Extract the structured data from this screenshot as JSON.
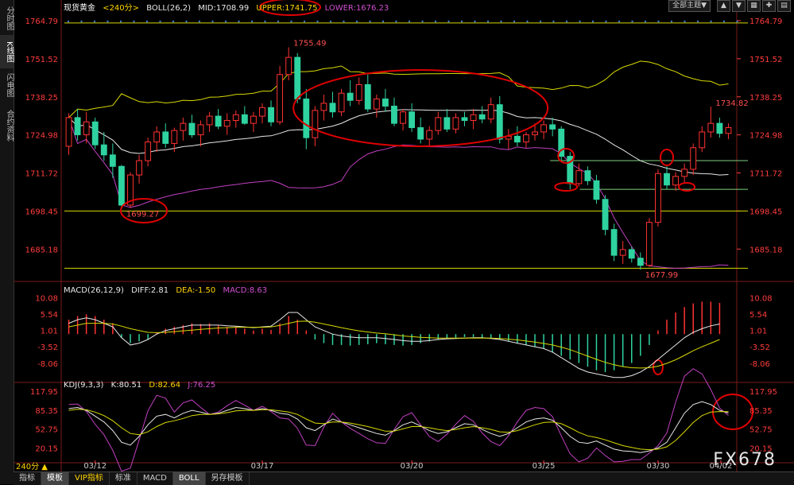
{
  "sidebar": {
    "tabs": [
      "分时图",
      "K线图",
      "闪电图",
      "合约资料"
    ]
  },
  "header": {
    "symbol": "现货黄金",
    "period": "<240分>",
    "boll_label": "BOLL(26,2)",
    "mid": "MID:1708.99",
    "upper": "UPPER:1741.75",
    "lower": "LOWER:1676.23",
    "theme_select": "全部主题▼"
  },
  "macd_header": {
    "title": "MACD(26,12,9)",
    "diff": "DIFF:2.81",
    "dea": "DEA:-1.50",
    "macd": "MACD:8.63"
  },
  "kdj_header": {
    "title": "KDJ(9,3,3)",
    "k": "K:80.51",
    "d": "D:82.64",
    "j": "J:76.25"
  },
  "bottom_tabs": [
    "指标",
    "模板",
    "VIP指标",
    "标准",
    "MACD",
    "BOLL",
    "另存模板"
  ],
  "period_button": "240分 ▲",
  "watermark": "FX678",
  "colors": {
    "up": "#ff3232",
    "down": "#2ed3a0",
    "upper": "#d8d800",
    "mid": "#e8e8e8",
    "lower": "#c040c0",
    "axis": "#ff3c3c",
    "annotation": "#e00000"
  },
  "chart_data": {
    "type": "candlestick",
    "price_axis": {
      "ticks": [
        "1764.79",
        "1751.52",
        "1738.25",
        "1724.98",
        "1711.72",
        "1698.45",
        "1685.18"
      ],
      "ylim": [
        1675,
        1767
      ]
    },
    "x_ticks": [
      "03/12",
      "03/17",
      "03/20",
      "03/25",
      "03/30",
      "04/02"
    ],
    "annotations": {
      "high": "1755.49",
      "low_left": "1699.27",
      "low": "1677.99",
      "last_high": "1734.82"
    },
    "horizontal_lines": [
      1764.0,
      1698.45,
      1678.5,
      1716.0,
      1706.0
    ],
    "candles": [
      [
        1721.0,
        1732.5,
        1718.0,
        1731.0
      ],
      [
        1731.0,
        1734.0,
        1723.0,
        1725.0
      ],
      [
        1725.0,
        1733.0,
        1722.0,
        1729.5
      ],
      [
        1729.5,
        1731.0,
        1720.0,
        1721.5
      ],
      [
        1721.5,
        1726.0,
        1716.0,
        1718.0
      ],
      [
        1718.0,
        1722.0,
        1710.0,
        1714.0
      ],
      [
        1714.0,
        1714.5,
        1699.27,
        1700.5
      ],
      [
        1700.5,
        1712.0,
        1699.5,
        1711.0
      ],
      [
        1711.0,
        1718.0,
        1708.0,
        1716.0
      ],
      [
        1716.0,
        1724.0,
        1714.0,
        1722.5
      ],
      [
        1722.5,
        1728.0,
        1719.0,
        1726.0
      ],
      [
        1726.0,
        1729.0,
        1720.5,
        1722.0
      ],
      [
        1722.0,
        1727.5,
        1719.0,
        1726.5
      ],
      [
        1726.5,
        1731.0,
        1723.0,
        1729.0
      ],
      [
        1729.0,
        1732.0,
        1724.0,
        1725.0
      ],
      [
        1725.0,
        1730.0,
        1721.0,
        1728.5
      ],
      [
        1728.5,
        1733.0,
        1726.0,
        1731.5
      ],
      [
        1731.5,
        1734.0,
        1727.0,
        1728.0
      ],
      [
        1728.0,
        1732.5,
        1725.0,
        1730.0
      ],
      [
        1730.0,
        1733.5,
        1727.5,
        1732.0
      ],
      [
        1732.0,
        1735.0,
        1728.5,
        1729.0
      ],
      [
        1729.0,
        1733.0,
        1726.0,
        1731.5
      ],
      [
        1731.5,
        1736.0,
        1729.0,
        1734.5
      ],
      [
        1734.5,
        1737.0,
        1728.0,
        1729.5
      ],
      [
        1729.5,
        1749.0,
        1728.5,
        1746.0
      ],
      [
        1746.0,
        1755.49,
        1744.0,
        1752.0
      ],
      [
        1752.0,
        1753.5,
        1736.0,
        1737.5
      ],
      [
        1737.5,
        1741.0,
        1720.0,
        1724.0
      ],
      [
        1724.0,
        1735.0,
        1721.0,
        1733.5
      ],
      [
        1733.5,
        1739.0,
        1730.0,
        1736.0
      ],
      [
        1736.0,
        1740.0,
        1731.0,
        1733.0
      ],
      [
        1733.0,
        1741.0,
        1731.5,
        1739.5
      ],
      [
        1739.5,
        1744.0,
        1735.0,
        1737.0
      ],
      [
        1737.0,
        1745.0,
        1735.5,
        1742.5
      ],
      [
        1742.5,
        1746.0,
        1733.0,
        1734.0
      ],
      [
        1734.0,
        1739.0,
        1731.0,
        1737.5
      ],
      [
        1737.5,
        1741.0,
        1733.0,
        1735.0
      ],
      [
        1735.0,
        1738.0,
        1728.0,
        1729.0
      ],
      [
        1729.0,
        1734.0,
        1726.5,
        1733.0
      ],
      [
        1733.0,
        1736.0,
        1726.0,
        1727.5
      ],
      [
        1727.5,
        1731.0,
        1722.0,
        1723.5
      ],
      [
        1723.5,
        1728.0,
        1721.0,
        1726.5
      ],
      [
        1726.5,
        1733.0,
        1725.0,
        1731.0
      ],
      [
        1731.0,
        1734.0,
        1726.0,
        1727.0
      ],
      [
        1727.0,
        1732.5,
        1725.5,
        1731.0
      ],
      [
        1731.0,
        1733.0,
        1728.0,
        1730.0
      ],
      [
        1730.0,
        1734.0,
        1727.0,
        1732.0
      ],
      [
        1732.0,
        1735.0,
        1729.0,
        1730.5
      ],
      [
        1730.5,
        1738.0,
        1729.0,
        1735.5
      ],
      [
        1735.5,
        1738.5,
        1722.0,
        1723.5
      ],
      [
        1723.5,
        1727.0,
        1720.0,
        1724.5
      ],
      [
        1724.5,
        1728.0,
        1721.0,
        1722.5
      ],
      [
        1722.5,
        1726.0,
        1720.5,
        1725.0
      ],
      [
        1725.0,
        1729.0,
        1723.0,
        1726.0
      ],
      [
        1726.0,
        1730.0,
        1723.5,
        1728.5
      ],
      [
        1728.5,
        1731.0,
        1724.5,
        1727.0
      ],
      [
        1727.0,
        1728.0,
        1716.0,
        1717.5
      ],
      [
        1717.5,
        1719.0,
        1706.0,
        1708.0
      ],
      [
        1708.0,
        1715.0,
        1707.0,
        1712.5
      ],
      [
        1712.5,
        1714.0,
        1707.5,
        1709.0
      ],
      [
        1709.0,
        1711.0,
        1701.0,
        1702.5
      ],
      [
        1702.5,
        1704.0,
        1690.0,
        1692.0
      ],
      [
        1692.0,
        1694.0,
        1681.0,
        1683.0
      ],
      [
        1683.0,
        1688.0,
        1680.0,
        1685.0
      ],
      [
        1685.0,
        1686.0,
        1680.5,
        1682.0
      ],
      [
        1682.0,
        1684.0,
        1677.99,
        1679.5
      ],
      [
        1679.5,
        1696.0,
        1679.0,
        1694.5
      ],
      [
        1694.5,
        1713.0,
        1693.0,
        1711.5
      ],
      [
        1711.5,
        1714.0,
        1706.0,
        1707.5
      ],
      [
        1707.5,
        1712.0,
        1705.5,
        1710.5
      ],
      [
        1710.5,
        1715.0,
        1708.0,
        1713.0
      ],
      [
        1713.0,
        1722.0,
        1711.0,
        1720.5
      ],
      [
        1720.5,
        1728.0,
        1719.0,
        1726.0
      ],
      [
        1726.0,
        1734.82,
        1724.0,
        1729.0
      ],
      [
        1729.0,
        1731.0,
        1724.0,
        1725.5
      ],
      [
        1725.5,
        1729.0,
        1723.5,
        1727.5
      ]
    ],
    "macd": {
      "ticks": [
        "10.08",
        "5.54",
        "1.01",
        "-3.52",
        "-8.06"
      ],
      "ylim": [
        -12.5,
        11.5
      ],
      "hist": [
        4,
        5,
        5.5,
        5,
        4,
        3,
        -1,
        -2.5,
        -2,
        -1.5,
        0.5,
        1.5,
        2,
        2.5,
        3,
        2.8,
        3,
        2.5,
        2,
        2,
        1.5,
        1,
        1.5,
        1.2,
        3,
        5,
        4,
        1,
        -1.5,
        -2.5,
        -3,
        -3,
        -3.2,
        -3,
        -2.8,
        -2.5,
        -2.8,
        -3,
        -3.2,
        -3,
        -2.5,
        -2,
        -1.5,
        -1.2,
        -1,
        -0.8,
        -0.8,
        -1,
        -1.2,
        -1.5,
        -2,
        -2.5,
        -3,
        -3.5,
        -4,
        -5,
        -6,
        -7,
        -8,
        -9,
        -10,
        -10.5,
        -10,
        -9,
        -8,
        -6,
        -3,
        1,
        4,
        6,
        7.5,
        8.5,
        9,
        9,
        8.63
      ],
      "diff": [
        3,
        4,
        4.5,
        4,
        3,
        2,
        -1,
        -3,
        -2.5,
        -1.5,
        0,
        1,
        1.5,
        2,
        2.5,
        2.5,
        2.5,
        2.5,
        2.3,
        2.2,
        2,
        1.8,
        2,
        2.2,
        4,
        6,
        6,
        4,
        2,
        1,
        0,
        -0.5,
        -0.8,
        -1,
        -1,
        -1,
        -1.2,
        -1.5,
        -1.8,
        -2,
        -2,
        -1.8,
        -1.5,
        -1.3,
        -1.2,
        -1.1,
        -1,
        -1,
        -1.2,
        -1.5,
        -2,
        -2.5,
        -3,
        -3.5,
        -4,
        -5,
        -6.5,
        -8,
        -9.5,
        -10.5,
        -11,
        -11.5,
        -12,
        -12,
        -11.5,
        -10.5,
        -9,
        -7,
        -5,
        -3,
        -1,
        0.5,
        1.5,
        2.3,
        2.81
      ],
      "dea": [
        2,
        2.5,
        3,
        3,
        3,
        2.8,
        2.2,
        1.5,
        1,
        0.5,
        0.4,
        0.5,
        0.7,
        0.9,
        1.1,
        1.3,
        1.5,
        1.7,
        1.8,
        1.9,
        1.9,
        1.9,
        1.9,
        2,
        2.4,
        3,
        3.5,
        3.6,
        3.3,
        2.8,
        2.3,
        1.8,
        1.3,
        0.9,
        0.6,
        0.3,
        0.1,
        -0.2,
        -0.5,
        -0.7,
        -0.9,
        -1,
        -1.1,
        -1.1,
        -1.1,
        -1.1,
        -1.1,
        -1.1,
        -1.1,
        -1.2,
        -1.4,
        -1.6,
        -1.9,
        -2.2,
        -2.6,
        -3,
        -3.6,
        -4.3,
        -5.2,
        -6.1,
        -7,
        -7.8,
        -8.5,
        -9,
        -9.3,
        -9.4,
        -9.3,
        -8.9,
        -8.1,
        -7.1,
        -5.9,
        -4.6,
        -3.5,
        -2.5,
        -1.5
      ]
    },
    "kdj": {
      "ticks": [
        "117.95",
        "85.35",
        "52.75",
        "20.15"
      ],
      "ylim": [
        0,
        125
      ],
      "k": [
        88,
        90,
        85,
        75,
        65,
        50,
        30,
        25,
        40,
        60,
        75,
        78,
        72,
        80,
        85,
        82,
        78,
        80,
        85,
        90,
        88,
        85,
        88,
        85,
        80,
        78,
        70,
        55,
        50,
        60,
        70,
        65,
        60,
        55,
        50,
        45,
        42,
        50,
        60,
        65,
        58,
        50,
        45,
        48,
        55,
        62,
        60,
        52,
        45,
        40,
        45,
        55,
        65,
        70,
        72,
        68,
        55,
        40,
        30,
        28,
        32,
        25,
        18,
        15,
        14,
        12,
        15,
        20,
        30,
        55,
        80,
        95,
        100,
        95,
        85,
        80.51
      ],
      "d": [
        85,
        87,
        86,
        82,
        76,
        67,
        55,
        45,
        43,
        48,
        57,
        64,
        67,
        71,
        76,
        78,
        78,
        79,
        81,
        84,
        85,
        85,
        86,
        86,
        84,
        82,
        78,
        70,
        63,
        62,
        65,
        65,
        63,
        60,
        57,
        53,
        49,
        49,
        53,
        57,
        57,
        55,
        52,
        50,
        52,
        55,
        57,
        55,
        52,
        48,
        47,
        50,
        55,
        60,
        64,
        65,
        62,
        55,
        47,
        41,
        38,
        34,
        29,
        24,
        21,
        18,
        17,
        18,
        22,
        33,
        48,
        64,
        76,
        82,
        83,
        82.64
      ],
      "j": [
        95,
        96,
        83,
        61,
        43,
        16,
        -20,
        -15,
        34,
        84,
        111,
        106,
        82,
        98,
        103,
        90,
        78,
        82,
        93,
        102,
        94,
        85,
        92,
        83,
        72,
        70,
        54,
        25,
        24,
        56,
        80,
        65,
        54,
        45,
        36,
        29,
        28,
        52,
        74,
        81,
        60,
        40,
        31,
        44,
        61,
        76,
        66,
        46,
        31,
        24,
        41,
        65,
        85,
        90,
        88,
        74,
        41,
        10,
        -4,
        2,
        20,
        7,
        -4,
        -3,
        0,
        0,
        11,
        24,
        46,
        99,
        144,
        157,
        148,
        121,
        89,
        76.25
      ]
    }
  }
}
